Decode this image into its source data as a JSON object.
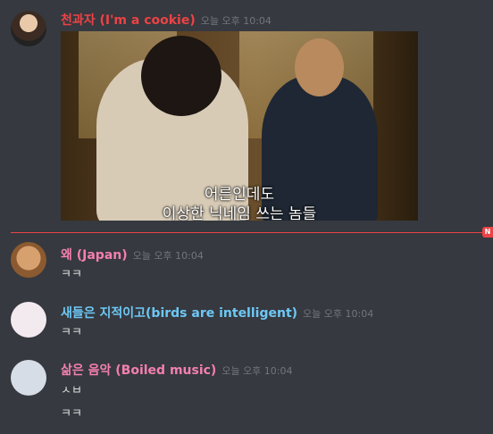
{
  "messages": [
    {
      "username": "천과자 (I'm a cookie)",
      "timestamp": "오늘 오후 10:04",
      "color": "#ed4245",
      "caption_line1": "어른인데도",
      "caption_line2": "이상한 닉네임 쓰는 놈들"
    },
    {
      "username": "왜 (Japan)",
      "timestamp": "오늘 오후 10:04",
      "color": "#f47fb0",
      "lines": [
        "ㅋㅋ"
      ]
    },
    {
      "username": "새들은 지적이고(birds are intelligent)",
      "timestamp": "오늘 오후 10:04",
      "color": "#6ec8f5",
      "lines": [
        "ㅋㅋ"
      ]
    },
    {
      "username": "삶은 음악 (Boiled music)",
      "timestamp": "오늘 오후 10:04",
      "color": "#f47fb0",
      "lines": [
        "ㅅㅂ",
        "ㅋㅋ"
      ]
    }
  ],
  "new_divider_label": "N",
  "icons": {
    "avatar1": "avatar-girl-flower-icon",
    "avatar2": "avatar-face-icon",
    "avatar3": "avatar-bird-icon",
    "avatar4": "avatar-penguin-icon"
  }
}
